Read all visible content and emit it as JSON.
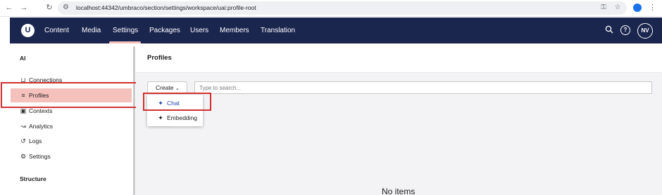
{
  "browser": {
    "url": "localhost:44342/umbraco/section/settings/workspace/uai:profile-root",
    "back_icon": "arrow-left-icon",
    "forward_icon": "arrow-right-icon",
    "reload_icon": "reload-icon"
  },
  "header": {
    "nav": [
      "Content",
      "Media",
      "Settings",
      "Packages",
      "Users",
      "Members",
      "Translation"
    ],
    "active_nav": "Settings",
    "avatar": "NV",
    "colors": {
      "header_bg": "#1b264f",
      "active_accent": "#f5c1bc"
    }
  },
  "sidebar": {
    "section_title": "AI",
    "items": [
      {
        "label": "Connections",
        "icon": "plug-icon"
      },
      {
        "label": "Profiles",
        "icon": "sliders-icon"
      },
      {
        "label": "Contexts",
        "icon": "context-icon"
      },
      {
        "label": "Analytics",
        "icon": "chart-icon"
      },
      {
        "label": "Logs",
        "icon": "history-icon"
      },
      {
        "label": "Settings",
        "icon": "gear-icon"
      }
    ],
    "active_item": "Profiles",
    "structure_title": "Structure"
  },
  "main": {
    "title": "Profiles",
    "create_label": "Create",
    "search_placeholder": "Type to search...",
    "create_menu": [
      {
        "label": "Chat",
        "icon": "wand-icon"
      },
      {
        "label": "Embedding",
        "icon": "wand-icon"
      }
    ],
    "empty_text": "No items"
  }
}
